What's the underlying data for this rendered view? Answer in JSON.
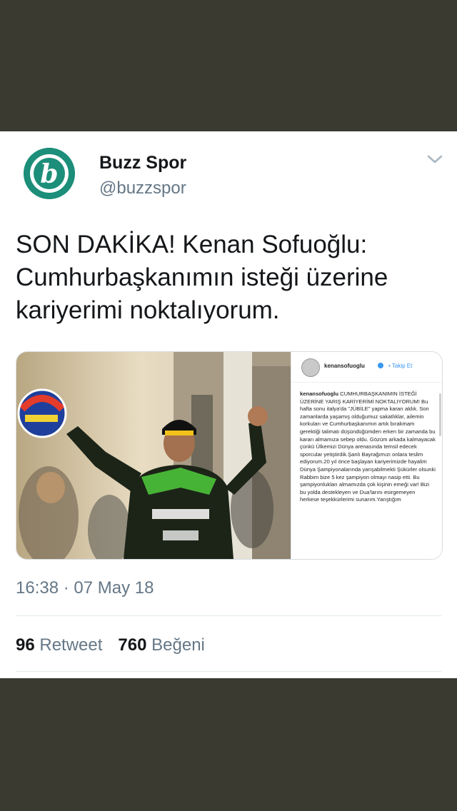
{
  "tweet": {
    "author_name": "Buzz Spor",
    "author_handle": "@buzzspor",
    "avatar_letter": "b",
    "text": "SON DAKİKA! Kenan Sofuoğlu: Cumhurbaşkanımın isteği üzerine kariyerimi noktalıyorum.",
    "timestamp": "16:38 · 07 May 18",
    "retweet_count": "96",
    "retweet_label": "Retweet",
    "like_count": "760",
    "like_label": "Beğeni"
  },
  "media": {
    "photo_icon": "rider-photo",
    "insta_user": "kenansofuoglu",
    "insta_follow": "• Takip Et",
    "insta_caption_user": "kenansofuoglu",
    "insta_caption": "CUMHURBAŞKANIMIN İSTEĞİ ÜZERİNE YARIŞ KARİYERİMİ NOKTALIYORUM! Bu hafta sonu italya'da \"JÜBİLE\" yapma kararı aldık. Son zamanlarda yaşamış olduğumuz sakatlıklar, ailemin korkuları ve Cumhurbaşkanımın artık bırakmam gerektiği talimatı düşündüğümden erken bir zamanda bu kararı almamıza sebep oldu. Gözüm arkada kalmayacak çünkü Ülkemizi Dünya arenasında temsil edecek sporcular yetiştirdik.Şanlı Bayrağımızı onlara teslim ediyorum.20 yıl önce başlayan kariyerimizde hayalim Dünya Şampiyonalarında yarışabilmekti Şükürler olsunki Rabbim bize 5 kez şampiyon olmayı nasip etti. Bu şampiyonlukları almamızda çok kişinin emeği var! Bizi bu yolda destekleyen ve Dua'larını esirgemeyen herkese teşekkürlerimi sunarım.Yarıştığım"
  },
  "colors": {
    "background": "#3b3a31",
    "card": "#ffffff",
    "avatar_green": "#1c8e79",
    "text_primary": "#14171a",
    "text_secondary": "#657786"
  }
}
